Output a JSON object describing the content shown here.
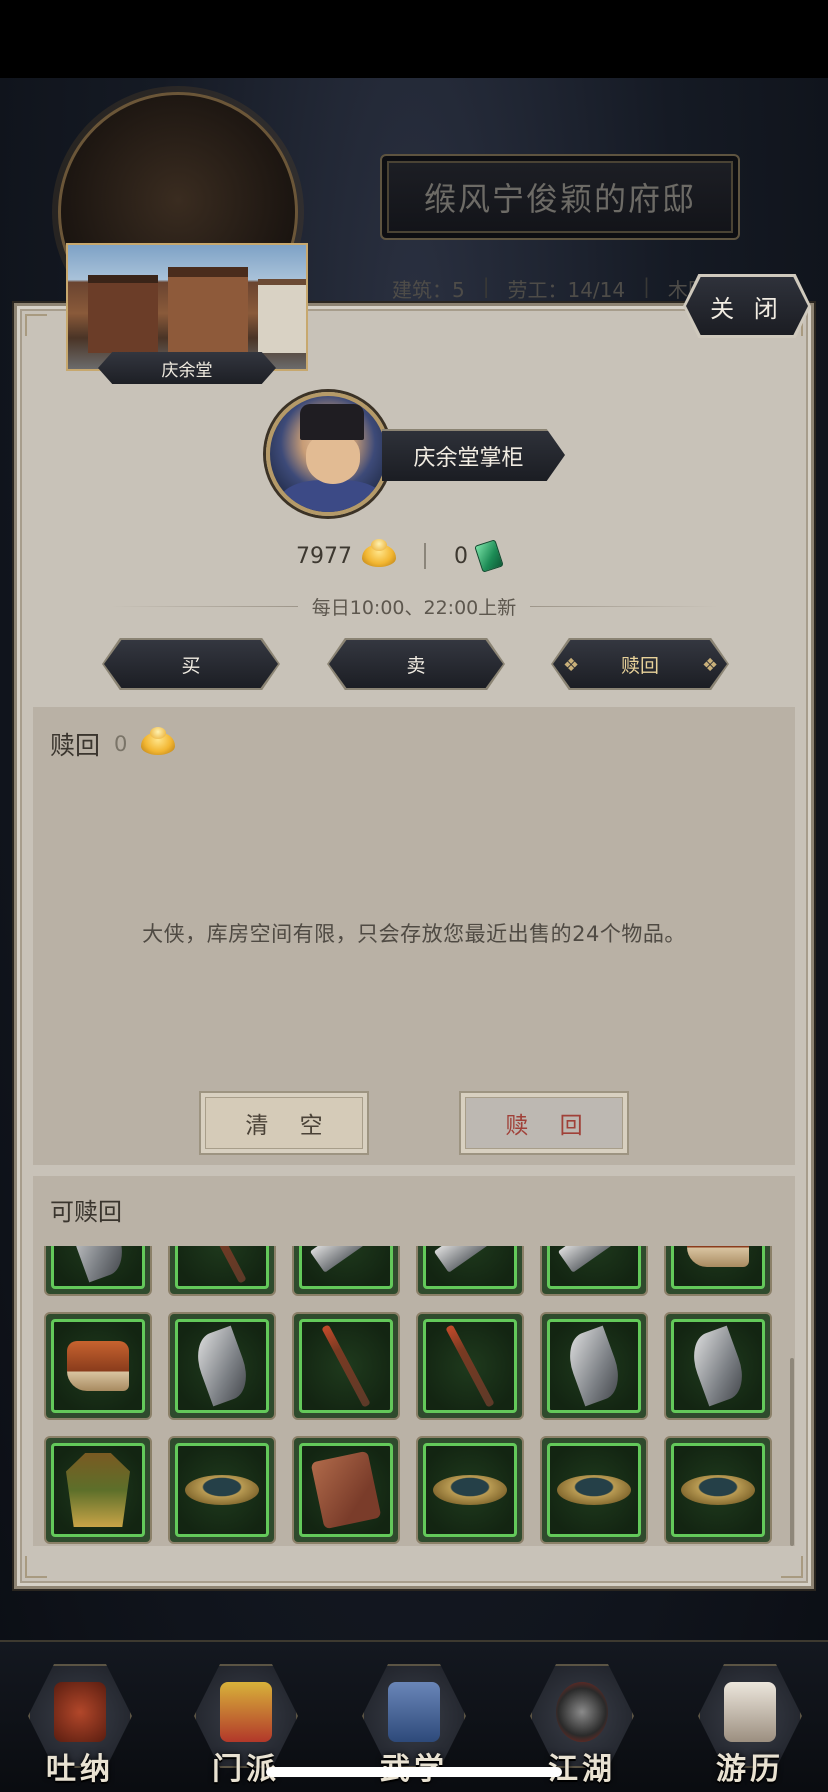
{
  "background": {
    "residence_title": "缑风宁俊颖的府邸",
    "stats": [
      {
        "label": "建筑：5"
      },
      {
        "label": "劳工：14/14"
      },
      {
        "label": "木匠："
      }
    ]
  },
  "dialog": {
    "close_label": "关 闭",
    "shop_name": "庆余堂",
    "keeper_name": "庆余堂掌柜",
    "currency": {
      "gold": "7977",
      "jade": "0",
      "gold_icon": "gold-ingot-icon",
      "jade_icon": "jade-token-icon"
    },
    "refresh_text": "每日10:00、22:00上新",
    "tabs": [
      {
        "label": "买",
        "active": false
      },
      {
        "label": "卖",
        "active": false
      },
      {
        "label": "赎回",
        "active": true
      }
    ],
    "redeem": {
      "title": "赎回",
      "cost": "0",
      "notice": "大侠，库房空间有限，只会存放您最近出售的24个物品。",
      "clear_label": "清 空",
      "redeem_label": "赎 回"
    },
    "redeemable": {
      "title": "可赎回",
      "items": [
        {
          "icon": "saber-icon"
        },
        {
          "icon": "spear-icon"
        },
        {
          "icon": "blade-icon"
        },
        {
          "icon": "blade-icon"
        },
        {
          "icon": "blade-icon"
        },
        {
          "icon": "boots-icon"
        },
        {
          "icon": "boots-icon"
        },
        {
          "icon": "saber-icon"
        },
        {
          "icon": "spear-icon"
        },
        {
          "icon": "spear-icon"
        },
        {
          "icon": "saber-icon"
        },
        {
          "icon": "saber-icon"
        },
        {
          "icon": "robe-icon"
        },
        {
          "icon": "ring-icon"
        },
        {
          "icon": "scroll-icon"
        },
        {
          "icon": "ring-icon"
        },
        {
          "icon": "ring-icon"
        },
        {
          "icon": "ring-icon"
        }
      ]
    }
  },
  "bottom_nav": [
    {
      "label": "吐纳",
      "icon": "meditation-icon"
    },
    {
      "label": "门派",
      "icon": "sect-banner-icon"
    },
    {
      "label": "武学",
      "icon": "martial-book-icon"
    },
    {
      "label": "江湖",
      "icon": "jianghu-hat-icon"
    },
    {
      "label": "游历",
      "icon": "horse-icon"
    }
  ]
}
